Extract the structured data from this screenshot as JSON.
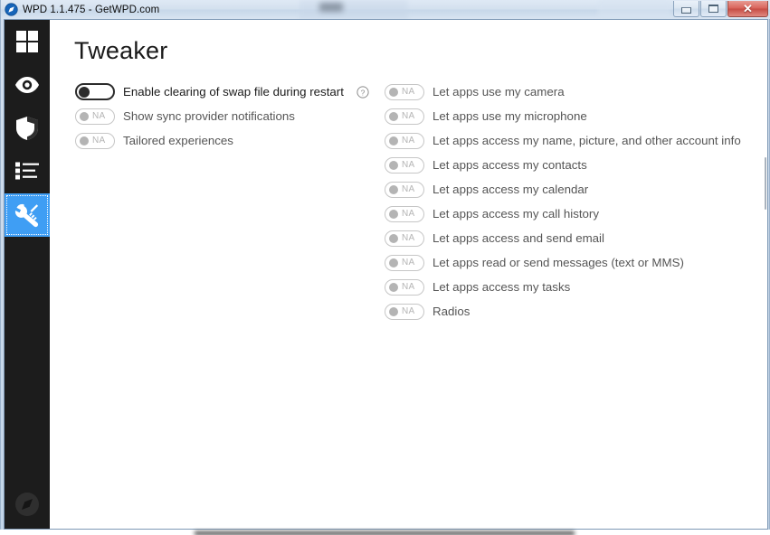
{
  "window": {
    "title": "WPD 1.1.475 - GetWPD.com",
    "app_icon": "compass-icon",
    "controls": {
      "minimize_label": "–",
      "maximize_label": "□",
      "close_label": "✕"
    },
    "accent_color": "#3f9ef4",
    "sidebar_color": "#1c1c1c",
    "close_button_color": "#d9635a"
  },
  "sidebar": {
    "items": [
      {
        "name": "dashboard",
        "icon": "grid-icon",
        "active": false
      },
      {
        "name": "privacy",
        "icon": "eye-icon",
        "active": false
      },
      {
        "name": "firewall",
        "icon": "shield-icon",
        "active": false
      },
      {
        "name": "appx",
        "icon": "list-icon",
        "active": false
      },
      {
        "name": "tweaker",
        "icon": "tools-icon",
        "active": true
      }
    ],
    "bottom_item": {
      "name": "about",
      "icon": "compass-icon"
    }
  },
  "main": {
    "title": "Tweaker",
    "left_column": [
      {
        "label": "Enable clearing of swap file during restart",
        "state": "off",
        "available": true,
        "has_help": true,
        "help_icon": "help-circle-icon"
      },
      {
        "label": "Show sync provider notifications",
        "state": "NA",
        "available": false,
        "has_help": false
      },
      {
        "label": "Tailored experiences",
        "state": "NA",
        "available": false,
        "has_help": false
      }
    ],
    "right_column": [
      {
        "label": "Let apps use my camera",
        "state": "NA",
        "available": false
      },
      {
        "label": "Let apps use my microphone",
        "state": "NA",
        "available": false
      },
      {
        "label": "Let apps access my name, picture, and other account info",
        "state": "NA",
        "available": false
      },
      {
        "label": "Let apps access my contacts",
        "state": "NA",
        "available": false
      },
      {
        "label": "Let apps access my calendar",
        "state": "NA",
        "available": false
      },
      {
        "label": "Let apps access my call history",
        "state": "NA",
        "available": false
      },
      {
        "label": "Let apps access and send email",
        "state": "NA",
        "available": false
      },
      {
        "label": "Let apps read or send messages (text or MMS)",
        "state": "NA",
        "available": false
      },
      {
        "label": "Let apps access my tasks",
        "state": "NA",
        "available": false
      },
      {
        "label": "Radios",
        "state": "NA",
        "available": false
      }
    ]
  }
}
